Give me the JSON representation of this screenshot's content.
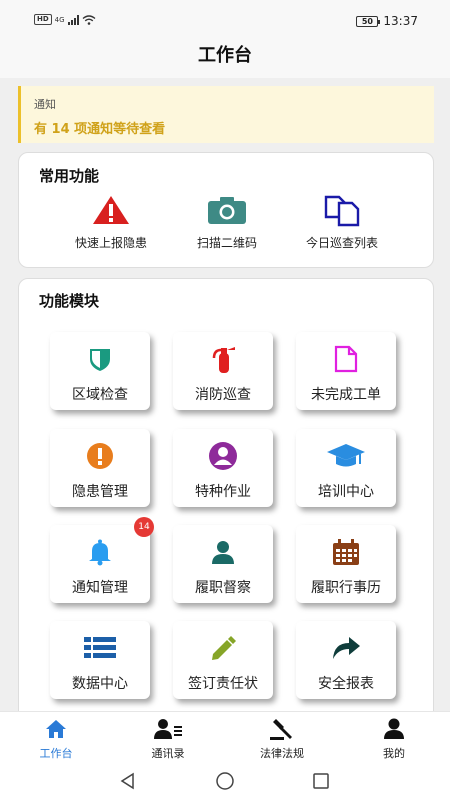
{
  "status": {
    "signal": "4G",
    "hd": "HD",
    "battery": "50",
    "time": "13:37"
  },
  "header": {
    "title": "工作台"
  },
  "notice": {
    "label": "通知",
    "text": "有 14 项通知等待查看"
  },
  "common": {
    "title": "常用功能",
    "items": [
      {
        "label": "快速上报隐患",
        "icon": "warning-icon",
        "color": "#d8201f"
      },
      {
        "label": "扫描二维码",
        "icon": "camera-icon",
        "color": "#3e8a85"
      },
      {
        "label": "今日巡查列表",
        "icon": "copy-icon",
        "color": "#1a1aa8"
      }
    ]
  },
  "modules": {
    "title": "功能模块",
    "items": [
      {
        "label": "区域检查",
        "icon": "shield-icon",
        "color": "#1a9a80"
      },
      {
        "label": "消防巡查",
        "icon": "fire-extinguisher-icon",
        "color": "#e02020"
      },
      {
        "label": "未完成工单",
        "icon": "document-icon",
        "color": "#e020e0"
      },
      {
        "label": "隐患管理",
        "icon": "alert-circle-icon",
        "color": "#e87d1d"
      },
      {
        "label": "特种作业",
        "icon": "user-circle-icon",
        "color": "#8e2a9a"
      },
      {
        "label": "培训中心",
        "icon": "graduation-cap-icon",
        "color": "#2a8de0"
      },
      {
        "label": "通知管理",
        "icon": "bell-icon",
        "color": "#2a9df0",
        "badge": "14"
      },
      {
        "label": "履职督察",
        "icon": "person-icon",
        "color": "#1a6a66"
      },
      {
        "label": "履职行事历",
        "icon": "calendar-icon",
        "color": "#8a3f16"
      },
      {
        "label": "数据中心",
        "icon": "list-icon",
        "color": "#1c5fa8"
      },
      {
        "label": "签订责任状",
        "icon": "pencil-icon",
        "color": "#86a528"
      },
      {
        "label": "安全报表",
        "icon": "share-arrow-icon",
        "color": "#0f3d3b"
      }
    ]
  },
  "tabs": [
    {
      "label": "工作台",
      "icon": "home-icon",
      "active": true
    },
    {
      "label": "通讯录",
      "icon": "contacts-icon"
    },
    {
      "label": "法律法规",
      "icon": "gavel-icon"
    },
    {
      "label": "我的",
      "icon": "profile-icon"
    }
  ],
  "colors": {
    "accent": "#2a7ad6",
    "notice_bg": "#fdf7dc",
    "notice_text": "#d0a21a",
    "badge": "#e53935"
  }
}
